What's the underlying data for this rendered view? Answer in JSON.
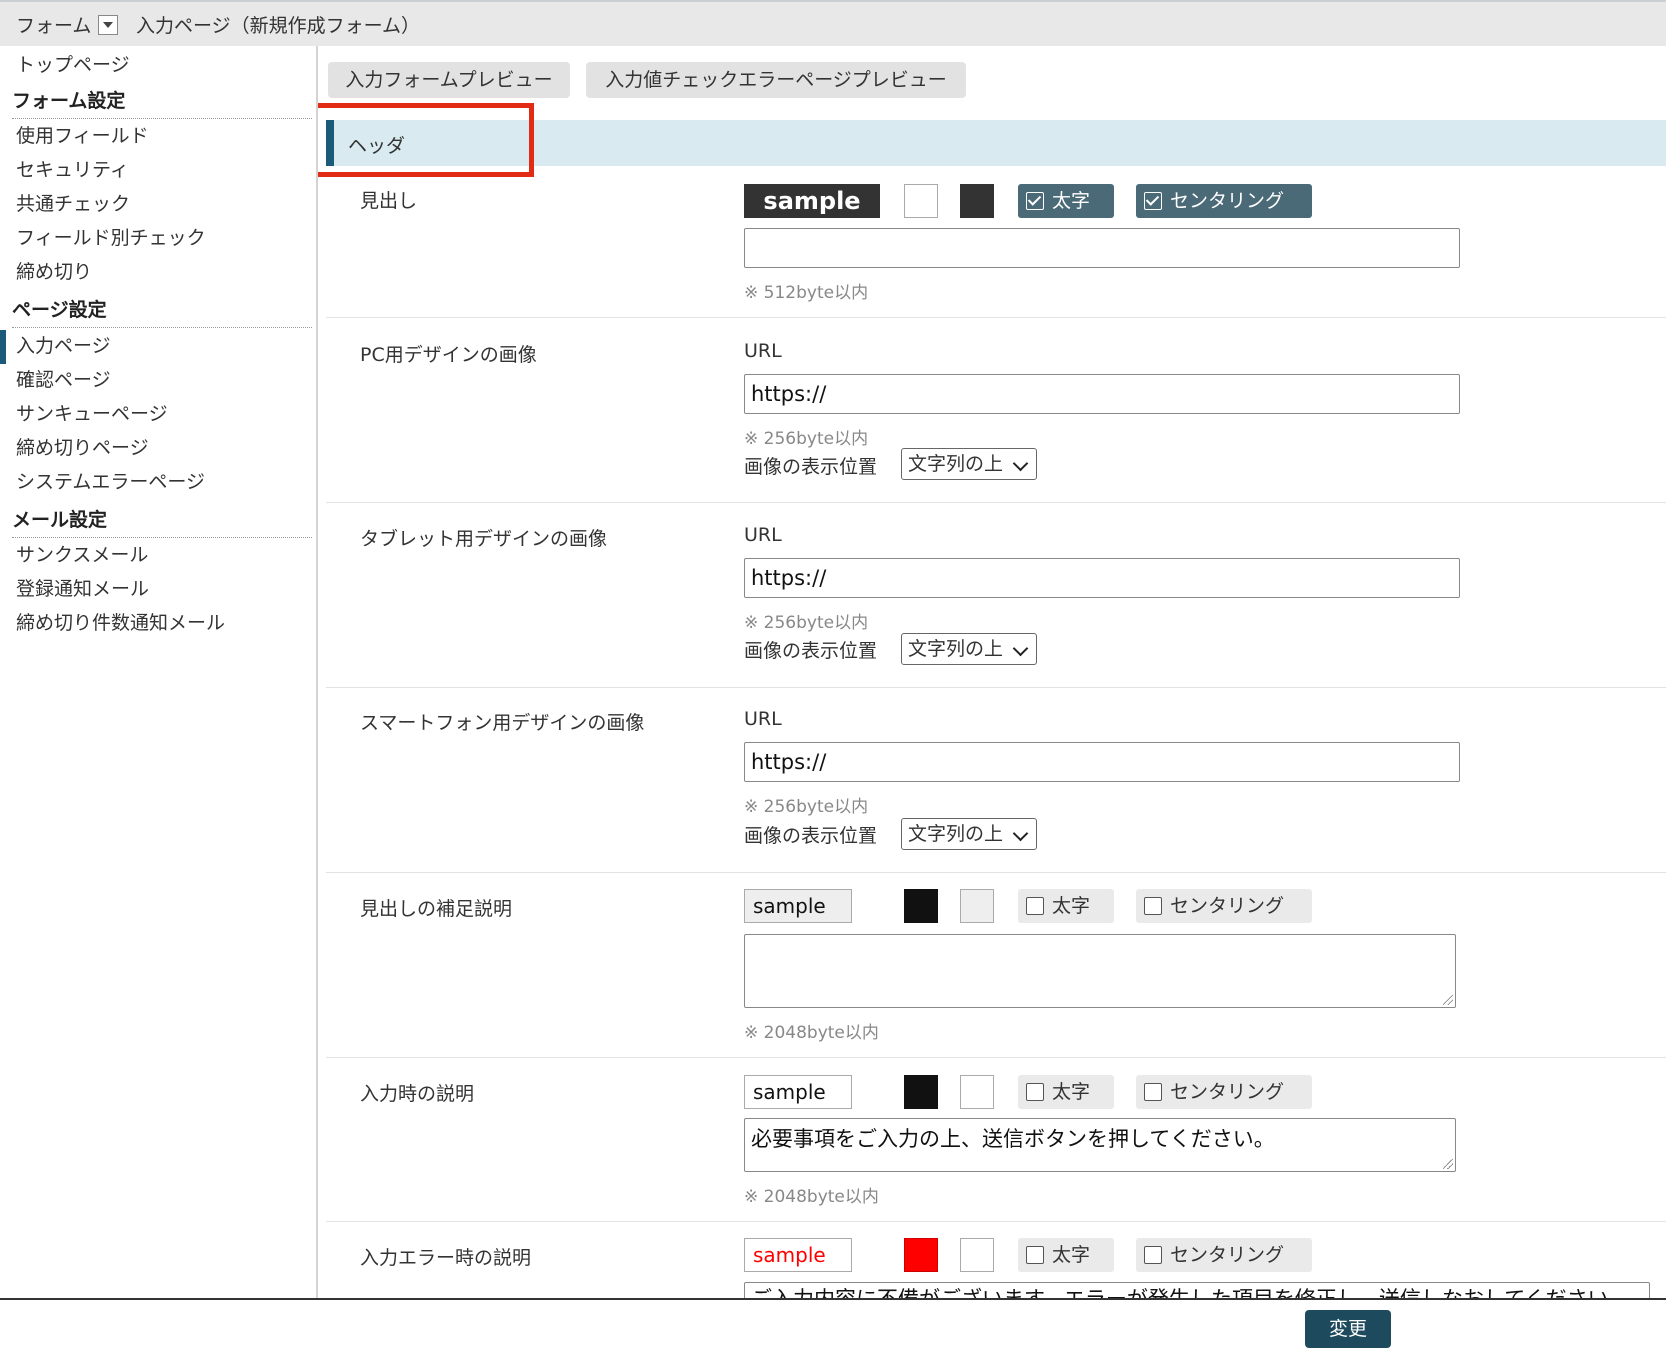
{
  "breadcrumb": {
    "form": "フォーム",
    "page": "入力ページ（新規作成フォーム）"
  },
  "sidebar": {
    "top": "トップページ",
    "form_settings": {
      "heading": "フォーム設定",
      "items": [
        "使用フィールド",
        "セキュリティ",
        "共通チェック",
        "フィールド別チェック",
        "締め切り"
      ]
    },
    "page_settings": {
      "heading": "ページ設定",
      "items": [
        "入力ページ",
        "確認ページ",
        "サンキューページ",
        "締め切りページ",
        "システムエラーページ"
      ],
      "active": "入力ページ"
    },
    "mail_settings": {
      "heading": "メール設定",
      "items": [
        "サンクスメール",
        "登録通知メール",
        "締め切り件数通知メール"
      ]
    }
  },
  "tabs": {
    "preview": "入力フォームプレビュー",
    "error_preview": "入力値チェックエラーページプレビュー"
  },
  "section": {
    "title": "ヘッダ"
  },
  "rows": {
    "heading": {
      "label": "見出し",
      "sample": "sample",
      "bold": "太字",
      "center": "センタリング",
      "bold_checked": true,
      "center_checked": true,
      "value": "",
      "note": "※ 512byte以内",
      "color_fg": "#ffffff",
      "color_bg": "#333333"
    },
    "pc": {
      "label": "PC用デザインの画像",
      "url_label": "URL",
      "url": "https://",
      "note": "※ 256byte以内",
      "pos_label": "画像の表示位置",
      "pos": "文字列の上"
    },
    "tablet": {
      "label": "タブレット用デザインの画像",
      "url_label": "URL",
      "url": "https://",
      "note": "※ 256byte以内",
      "pos_label": "画像の表示位置",
      "pos": "文字列の上"
    },
    "smartphone": {
      "label": "スマートフォン用デザインの画像",
      "url_label": "URL",
      "url": "https://",
      "note": "※ 256byte以内",
      "pos_label": "画像の表示位置",
      "pos": "文字列の上"
    },
    "heading_note": {
      "label": "見出しの補足説明",
      "sample": "sample",
      "bold": "太字",
      "center": "センタリング",
      "value": "",
      "note": "※ 2048byte以内",
      "color_fg": "#111111",
      "color_bg": "#eeeeee"
    },
    "input_desc": {
      "label": "入力時の説明",
      "sample": "sample",
      "bold": "太字",
      "center": "センタリング",
      "value": "必要事項をご入力の上、送信ボタンを押してください。",
      "note": "※ 2048byte以内",
      "color_fg": "#111111",
      "color_bg": "#ffffff"
    },
    "error_desc": {
      "label": "入力エラー時の説明",
      "sample": "sample",
      "bold": "太字",
      "center": "センタリング",
      "value": "ご入力内容に不備がございます。エラーが発生した項目を修正し、送信しなおしてください。",
      "color_fg": "#ff0000",
      "color_bg": "#ffffff"
    }
  },
  "footer": {
    "submit": "変更"
  },
  "colors": {
    "accent": "#1b5a78",
    "highlight": "#e22b14",
    "section_bg": "#d9ebf0",
    "toggle_on": "#4a6a78"
  }
}
